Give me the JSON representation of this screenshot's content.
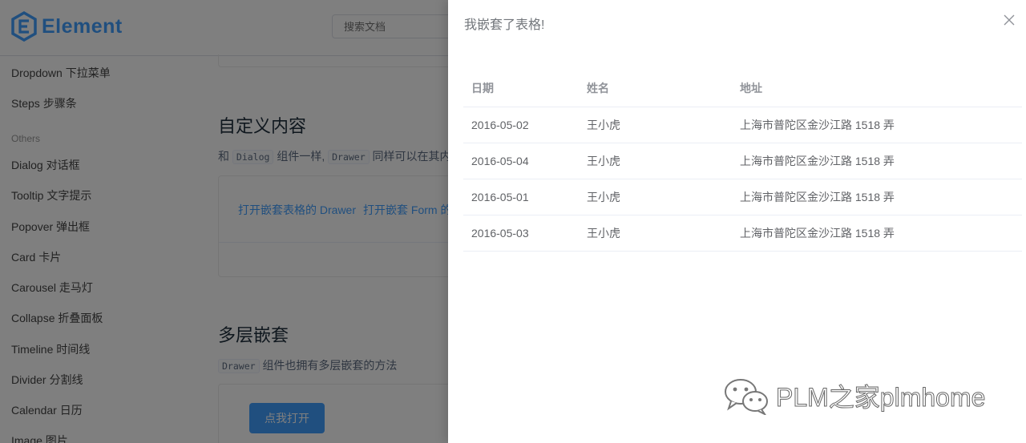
{
  "header": {
    "logo_text": "Element",
    "search_placeholder": "搜索文档"
  },
  "sidebar": {
    "items_top": [
      "Dropdown 下拉菜单",
      "Steps 步骤条"
    ],
    "group_others": "Others",
    "items_others": [
      "Dialog 对话框",
      "Tooltip 文字提示",
      "Popover 弹出框",
      "Card 卡片",
      "Carousel 走马灯",
      "Collapse 折叠面板",
      "Timeline 时间线",
      "Divider 分割线",
      "Calendar 日历",
      "Image 图片"
    ]
  },
  "main": {
    "custom_section": {
      "title": "自定义内容",
      "desc_prefix": "和",
      "desc_code1": "Dialog",
      "desc_mid": "组件一样,",
      "desc_code2": "Drawer",
      "desc_suffix": "同样可以在其内部",
      "link1": "打开嵌套表格的 Drawer",
      "link2": "打开嵌套 Form 的"
    },
    "nested_section": {
      "title": "多层嵌套",
      "desc_code": "Drawer",
      "desc_suffix": "组件也拥有多层嵌套的方法",
      "button_label": "点我打开"
    }
  },
  "drawer": {
    "title": "我嵌套了表格!",
    "close_icon": "close-icon",
    "table": {
      "headers": [
        "日期",
        "姓名",
        "地址"
      ],
      "rows": [
        [
          "2016-05-02",
          "王小虎",
          "上海市普陀区金沙江路 1518 弄"
        ],
        [
          "2016-05-04",
          "王小虎",
          "上海市普陀区金沙江路 1518 弄"
        ],
        [
          "2016-05-01",
          "王小虎",
          "上海市普陀区金沙江路 1518 弄"
        ],
        [
          "2016-05-03",
          "王小虎",
          "上海市普陀区金沙江路 1518 弄"
        ]
      ]
    }
  },
  "watermark": {
    "text": "PLM之家plmhome"
  },
  "colors": {
    "brand": "#409eff",
    "overlay": "rgba(0,0,0,0.5)"
  }
}
